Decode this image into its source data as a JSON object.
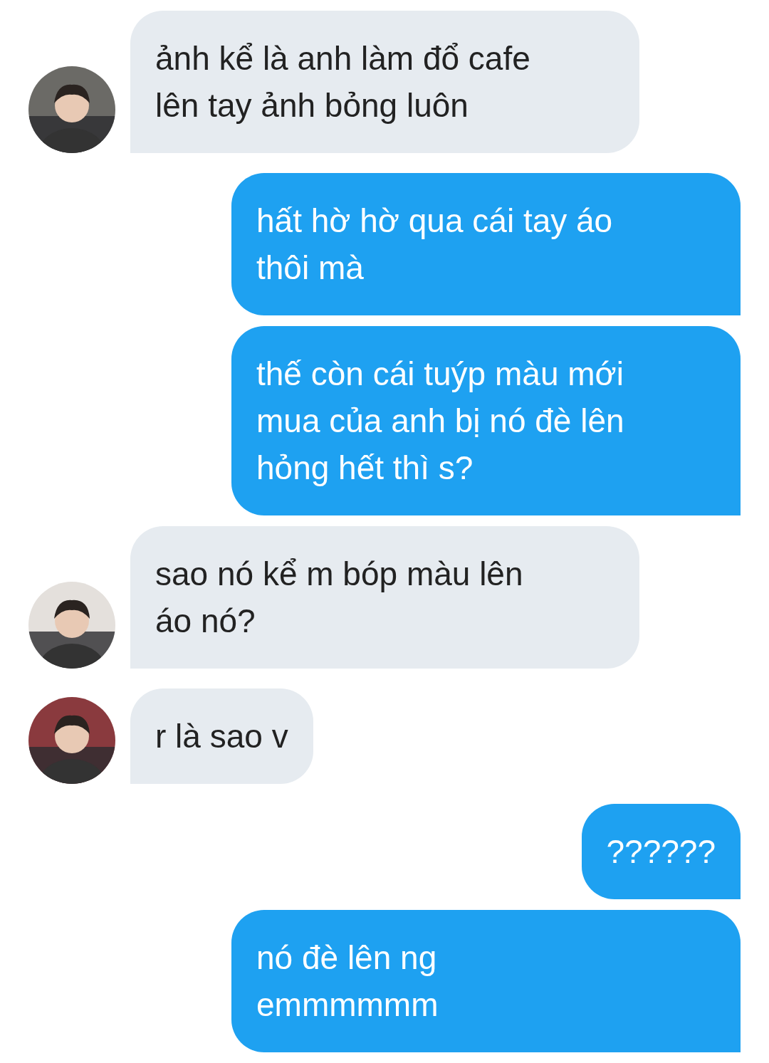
{
  "messages": [
    {
      "kind": "received",
      "avatar": {
        "kind": "picture",
        "color": "#6b6a66"
      },
      "lines": [
        "ảnh kể là anh làm đổ cafe",
        "lên tay ảnh bỏng luôn"
      ]
    },
    {
      "kind": "sent",
      "lines": [
        "hất hờ hờ qua cái tay áo",
        "thôi mà"
      ]
    },
    {
      "kind": "sent",
      "lines": [
        "thế còn cái tuýp màu mới",
        "mua của anh bị nó đè lên",
        "hỏng hết thì s?"
      ]
    },
    {
      "kind": "received",
      "avatar": {
        "kind": "picture",
        "color": "#e4e0dc"
      },
      "lines": [
        "sao nó kể m bóp màu lên",
        "áo nó?"
      ]
    },
    {
      "kind": "received",
      "avatar": {
        "kind": "picture",
        "color": "#8a3a3e"
      },
      "lines": [
        "r là sao v"
      ]
    },
    {
      "kind": "sent",
      "lines": [
        "??????"
      ]
    },
    {
      "kind": "sent",
      "lines": [
        "nó đè lên ng",
        "emmmmmm"
      ]
    }
  ]
}
